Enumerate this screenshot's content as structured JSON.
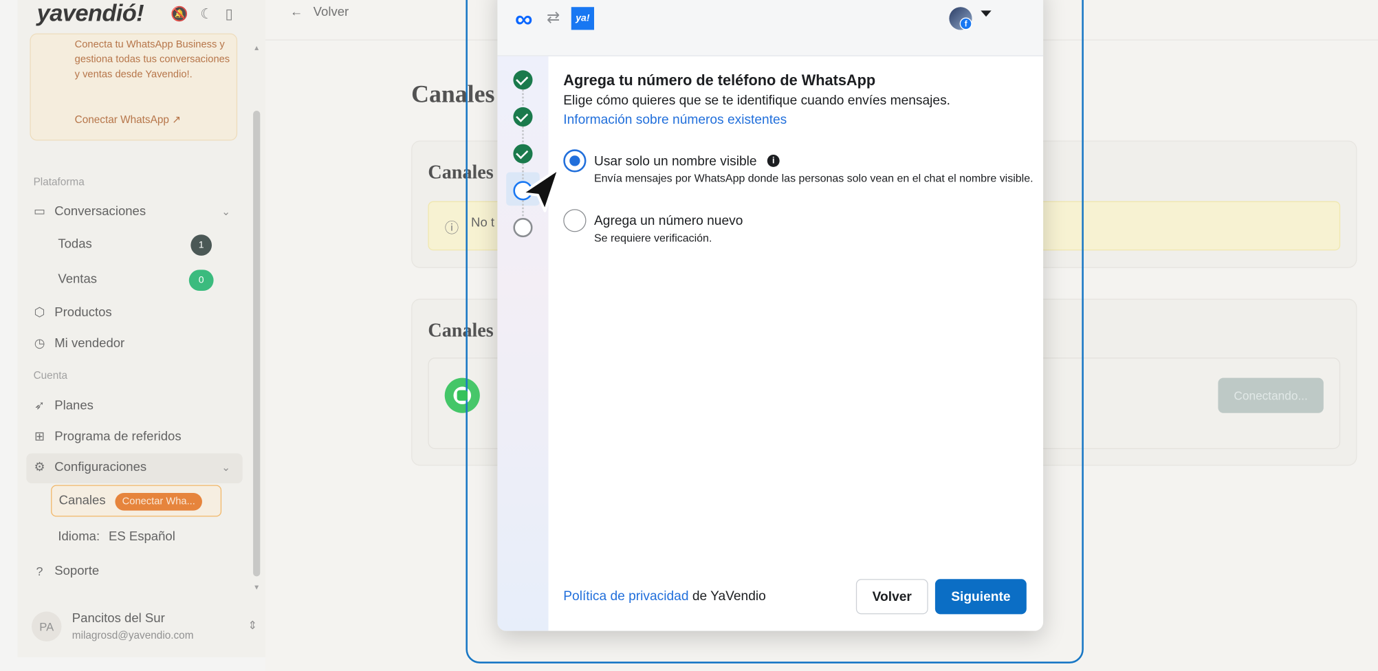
{
  "app": {
    "logo": "yavendió!",
    "promo_text": "Conecta tu WhatsApp Business y gestiona todas tus conversaciones y ventas desde Yavendio!.",
    "promo_link": "Conectar WhatsApp ↗",
    "section_platform": "Plataforma",
    "section_account": "Cuenta",
    "nav": {
      "conversations": "Conversaciones",
      "all": "Todas",
      "all_count": "1",
      "sales": "Ventas",
      "sales_count": "0",
      "products": "Productos",
      "my_seller": "Mi vendedor",
      "plans": "Planes",
      "referrals": "Programa de referidos",
      "settings": "Configuraciones",
      "channels": "Canales",
      "channels_badge": "Conectar Wha...",
      "language_label": "Idioma:",
      "language_value": "ES Español",
      "support": "Soporte"
    },
    "user": {
      "initials": "PA",
      "name": "Pancitos del Sur",
      "email": "milagrosd@yavendio.com"
    },
    "colors": {
      "accent": "#e47a2c",
      "count_dark": "#3c4a48",
      "count_green": "#2bb673"
    }
  },
  "main": {
    "back_label": "Volver",
    "page_title": "Canales",
    "card1_title": "Canales",
    "warning_text": "No t",
    "card2_title": "Canales",
    "connecting_button": "Conectando..."
  },
  "dialog": {
    "ya_logo": "ya!",
    "title": "Agrega tu número de teléfono de WhatsApp",
    "subtitle": "Elige cómo quieres que se te identifique cuando envíes mensajes.",
    "info_link": "Información sobre números existentes",
    "steps": [
      "done",
      "done",
      "done",
      "current",
      "todo"
    ],
    "option1": {
      "label": "Usar solo un nombre visible",
      "description": "Envía mensajes por WhatsApp donde las personas solo vean en el chat el nombre visible.",
      "selected": true
    },
    "option2": {
      "label": "Agrega un número nuevo",
      "description": "Se requiere verificación.",
      "selected": false
    },
    "privacy_link": "Política de privacidad",
    "privacy_tail": " de YaVendio",
    "back_button": "Volver",
    "next_button": "Siguiente",
    "colors": {
      "primary": "#0b6ec5",
      "link": "#216fdb",
      "step_done": "#1a7a4c"
    }
  }
}
